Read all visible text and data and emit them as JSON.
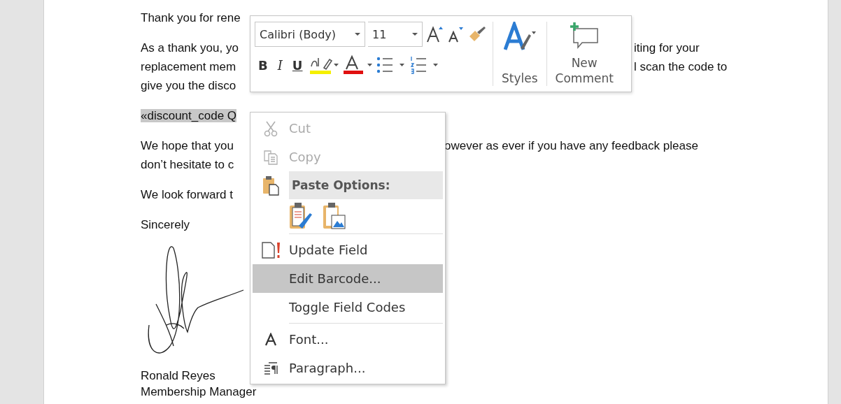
{
  "document": {
    "paragraphs": [
      {
        "lines": [
          {
            "left": "Thank you for rene"
          }
        ]
      },
      {
        "lines": [
          {
            "left": "As a thank you, yo",
            "right": "iting for your"
          },
          {
            "left": "replacement mem",
            "right": "l scan the code to"
          },
          {
            "left": "give you the disco"
          }
        ]
      },
      {
        "lines": [
          {
            "left": "«discount_code Q",
            "highlighted": true
          }
        ]
      },
      {
        "lines": [
          {
            "left": "We hope that you",
            "right": "owever as ever if you have any feedback please"
          },
          {
            "left": "don’t hesitate to c"
          }
        ]
      },
      {
        "lines": [
          {
            "left": "We look forward t"
          }
        ]
      },
      {
        "lines": [
          {
            "left": "Sincerely"
          }
        ]
      },
      {
        "lines": [
          {
            "left": "Ronald Reyes"
          },
          {
            "left": "Membership Manager"
          }
        ]
      }
    ]
  },
  "mini_toolbar": {
    "font": "Calibri (Body)",
    "size": "11",
    "format_buttons": [
      "B",
      "I",
      "U"
    ],
    "styles_label": "Styles",
    "comment_label": [
      "New",
      "Comment"
    ]
  },
  "context_menu": {
    "items": [
      {
        "kind": "item",
        "label": "Cut",
        "disabled": true,
        "selected": false,
        "divider_after": false
      },
      {
        "kind": "item",
        "label": "Copy",
        "disabled": true,
        "selected": false,
        "divider_after": false
      },
      {
        "kind": "header",
        "label": "Paste Options:"
      },
      {
        "kind": "paste-row",
        "divider_after": true
      },
      {
        "kind": "item",
        "label": "Update Field",
        "disabled": false,
        "selected": false,
        "divider_after": false
      },
      {
        "kind": "item",
        "label": "Edit Barcode...",
        "disabled": false,
        "selected": true,
        "divider_after": false
      },
      {
        "kind": "item",
        "label": "Toggle Field Codes",
        "disabled": false,
        "selected": false,
        "divider_after": true
      },
      {
        "kind": "item",
        "label": "Font...",
        "disabled": false,
        "selected": false,
        "divider_after": false
      },
      {
        "kind": "item",
        "label": "Paragraph...",
        "disabled": false,
        "selected": false,
        "divider_after": false
      }
    ]
  }
}
